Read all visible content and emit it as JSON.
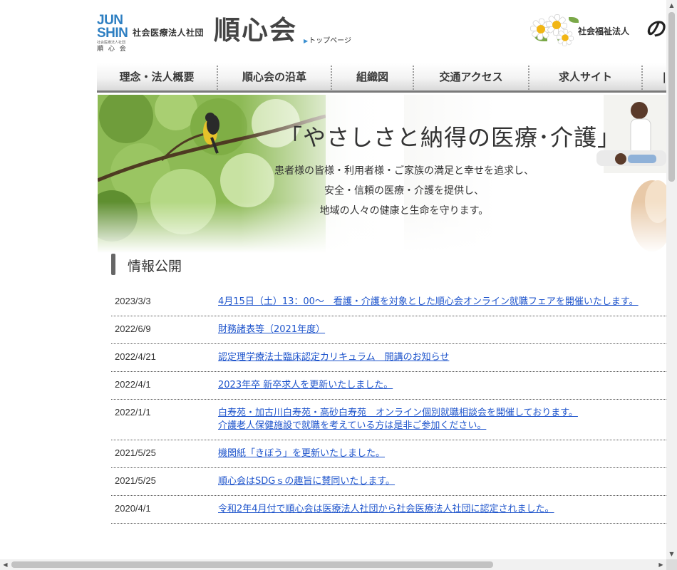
{
  "header": {
    "logo_line1": "JUN",
    "logo_line2": "SHIN",
    "logo_small": "社会医療法人社団",
    "logo_name": "順 心 会",
    "corp_type": "社会医療法人社団",
    "corp_name": "順心会",
    "top_link": "トップページ",
    "partner_type": "社会福祉法人",
    "partner_name": "の"
  },
  "nav": {
    "items": [
      {
        "label": "理念・法人概要"
      },
      {
        "label": "順心会の沿革"
      },
      {
        "label": "組織図"
      },
      {
        "label": "交通アクセス"
      },
      {
        "label": "求人サイト"
      },
      {
        "label": "|"
      }
    ]
  },
  "hero": {
    "title": "「やさしさと納得の医療･介護」",
    "lines": [
      "患者様の皆様・利用者様・ご家族の満足と幸せを追求し、",
      "安全・信頼の医療・介護を提供し、",
      "地域の人々の健康と生命を守ります。"
    ]
  },
  "info": {
    "title": "情報公開",
    "rows": [
      {
        "date": "2023/3/3",
        "links": [
          "4月15日（土）13：00～　看護・介護を対象とした順心会オンライン就職フェアを開催いたします。"
        ]
      },
      {
        "date": "2022/6/9",
        "links": [
          "財務諸表等（2021年度）"
        ]
      },
      {
        "date": "2022/4/21",
        "links": [
          "認定理学療法士臨床認定カリキュラム　開講のお知らせ"
        ]
      },
      {
        "date": "2022/4/1",
        "links": [
          "2023年卒 新卒求人を更新いたしました。"
        ]
      },
      {
        "date": "2022/1/1",
        "links": [
          "白寿苑・加古川白寿苑・高砂白寿苑　オンライン個別就職相談会を開催しております。",
          "介護老人保健施設で就職を考えている方は是非ご参加ください。"
        ]
      },
      {
        "date": "2021/5/25",
        "links": [
          "機関紙「きぼう」を更新いたしました。"
        ]
      },
      {
        "date": "2021/5/25",
        "links": [
          "順心会はSDGｓの趣旨に賛同いたします。"
        ]
      },
      {
        "date": "2020/4/1",
        "links": [
          "令和2年4月付で順心会は医療法人社団から社会医療法人社団に認定されました。"
        ]
      }
    ]
  },
  "colors": {
    "accent_blue": "#2e7fc2",
    "link_blue": "#1f55cc",
    "leaf_green": "#7aa848"
  }
}
